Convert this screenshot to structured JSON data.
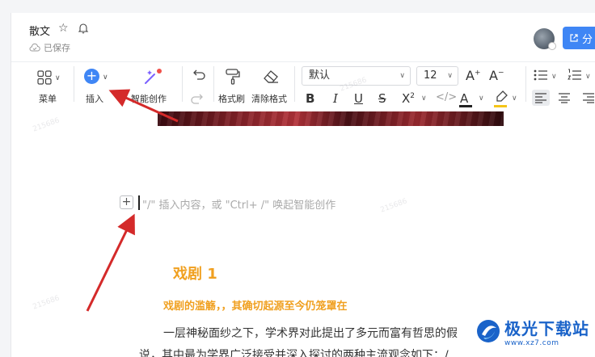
{
  "document": {
    "title": "散文",
    "saved_status": "已保存",
    "share_label": "分"
  },
  "toolbar": {
    "menu_label": "菜单",
    "insert_label": "插入",
    "ai_label": "智能创作",
    "format_brush_label": "格式刷",
    "clear_format_label": "清除格式",
    "font_family": "默认",
    "font_size": "12",
    "superscript_label": "X",
    "superscript_mark": "2",
    "color_letter": "A",
    "code_label": "</>",
    "size_up_letter": "A",
    "size_down_letter": "A",
    "size_up_sign": "+",
    "size_down_sign": "−",
    "bold": "B",
    "italic": "I",
    "underline": "U",
    "strike": "S",
    "colors": {
      "accent": "#3f86f5",
      "highlight": "#f5c518",
      "font_color": "#222222"
    }
  },
  "editor": {
    "block_insert_symbol": "+",
    "placeholder": "\"/\" 插入内容，或 \"Ctrl+ /\" 唤起智能创作",
    "heading": "戏剧 1",
    "subheading": "戏剧的滥觞，，其确切起源至今仍笼罩在",
    "paragraph_line1": "一层神秘面纱之下，学术界对此提出了多元而富有哲思的假",
    "paragraph_line2": "说，其中最为学界广泛接受并深入探讨的两种主流观念如下：/",
    "accent_color": "#f0a020"
  },
  "watermark_text": "215686",
  "logo": {
    "name_cn": "极光下载站",
    "name_en": "www.xz7.com",
    "color": "#1a63c9"
  },
  "icons": [
    "star-icon",
    "bell-icon",
    "cloud-check-icon",
    "grid-icon",
    "plus-circle-icon",
    "magic-wand-icon",
    "undo-icon",
    "redo-icon",
    "format-brush-icon",
    "eraser-icon",
    "bullet-list-icon",
    "numbered-list-icon",
    "align-left-icon",
    "align-center-icon",
    "align-right-icon",
    "highlighter-icon",
    "external-link-icon"
  ]
}
